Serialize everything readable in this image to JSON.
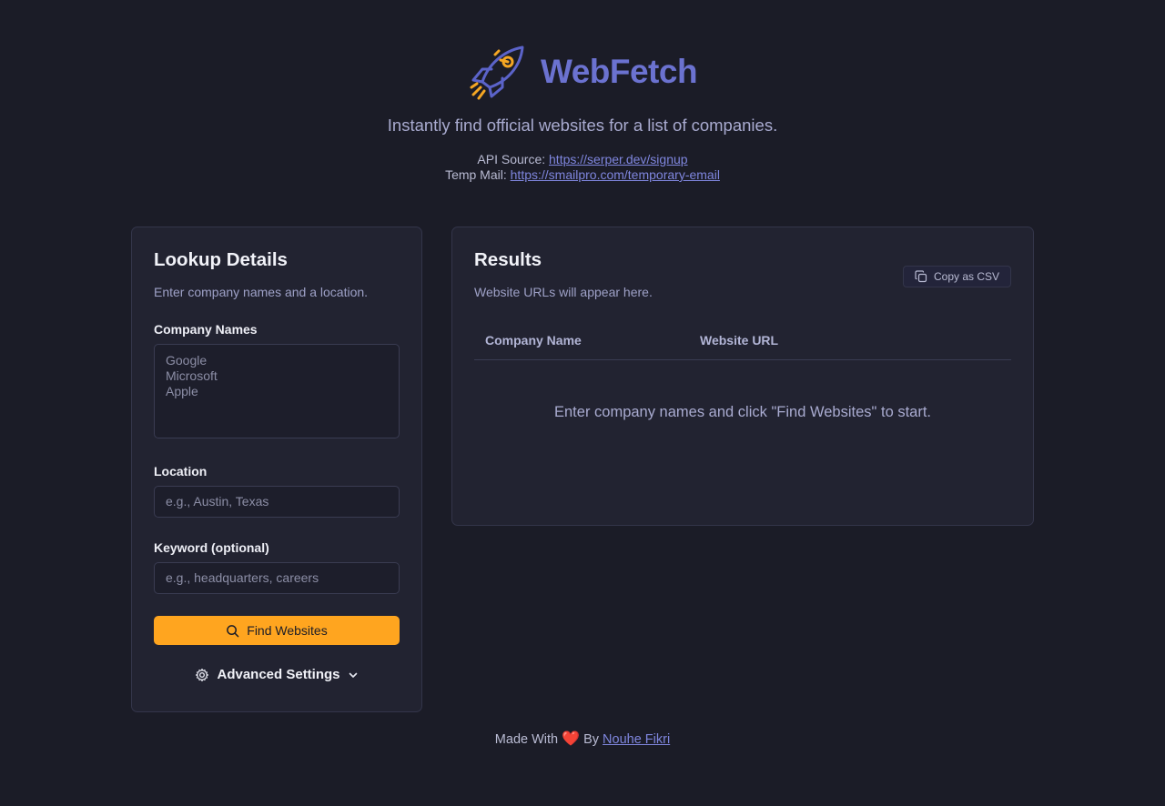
{
  "brand": {
    "title": "WebFetch",
    "tagline": "Instantly find official websites for a list of companies."
  },
  "sources": {
    "api_label": "API Source:",
    "api_link": "https://serper.dev/signup",
    "mail_label": "Temp Mail:",
    "mail_link": "https://smailpro.com/temporary-email"
  },
  "lookup": {
    "title": "Lookup Details",
    "subtitle": "Enter company names and a location.",
    "company_label": "Company Names",
    "company_placeholder": [
      "Google",
      "Microsoft",
      "Apple"
    ],
    "location_label": "Location",
    "location_placeholder": "e.g., Austin, Texas",
    "keyword_label": "Keyword (optional)",
    "keyword_placeholder": "e.g., headquarters, careers",
    "find_button": "Find Websites",
    "advanced": "Advanced Settings"
  },
  "results": {
    "title": "Results",
    "subtitle": "Website URLs will appear here.",
    "copy_button": "Copy as CSV",
    "columns": [
      "Company Name",
      "Website URL"
    ],
    "empty_message": "Enter company names and click \"Find Websites\" to start."
  },
  "footer": {
    "prefix": "Made With",
    "heart": "❤️",
    "by": "By",
    "author": "Nouhe Fikri"
  },
  "colors": {
    "accent": "#ffa51f",
    "brand": "#6b72d0",
    "background": "#1b1c27",
    "panel": "#222331"
  }
}
